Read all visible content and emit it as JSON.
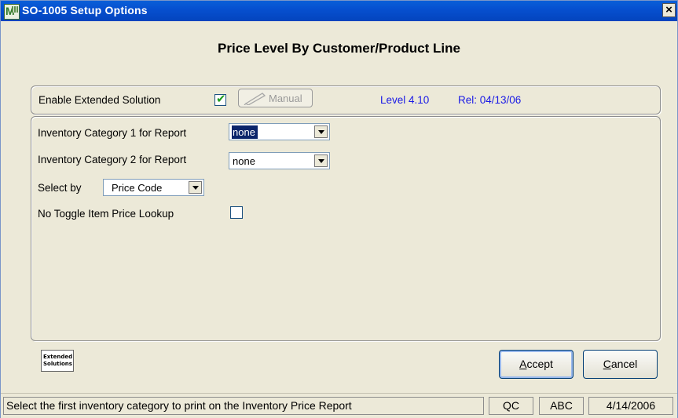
{
  "window": {
    "title": "SO-1005 Setup Options",
    "close_glyph": "×"
  },
  "heading": "Price Level By Customer/Product Line",
  "extended": {
    "enable_label": "Enable Extended Solution",
    "enable_checked": true,
    "manual_label": "Manual",
    "level": "Level 4.10",
    "release": "Rel: 04/13/06"
  },
  "options": {
    "cat1_label": "Inventory Category 1 for Report",
    "cat1_value": "none",
    "cat2_label": "Inventory Category 2 for Report",
    "cat2_value": "none",
    "select_by_label": "Select by",
    "select_by_value": "Price Code",
    "no_toggle_label": "No Toggle Item Price Lookup",
    "no_toggle_checked": false
  },
  "logo": {
    "line1": "Extended",
    "line2": "Solutions"
  },
  "buttons": {
    "accept_hotkey": "A",
    "accept_rest": "ccept",
    "cancel_hotkey": "C",
    "cancel_rest": "ancel"
  },
  "status": {
    "message": "Select the first inventory category to print on the Inventory Price Report",
    "module": "QC",
    "company": "ABC",
    "date": "4/14/2006"
  },
  "icons": {
    "app": "mas90-app-icon",
    "check": "checkmark-icon",
    "pencil": "pencil-icon",
    "dropdown": "chevron-down-icon"
  },
  "colors": {
    "titlebar": "#0650d0",
    "version_text": "#1919e6",
    "selection": "#0a246a"
  }
}
